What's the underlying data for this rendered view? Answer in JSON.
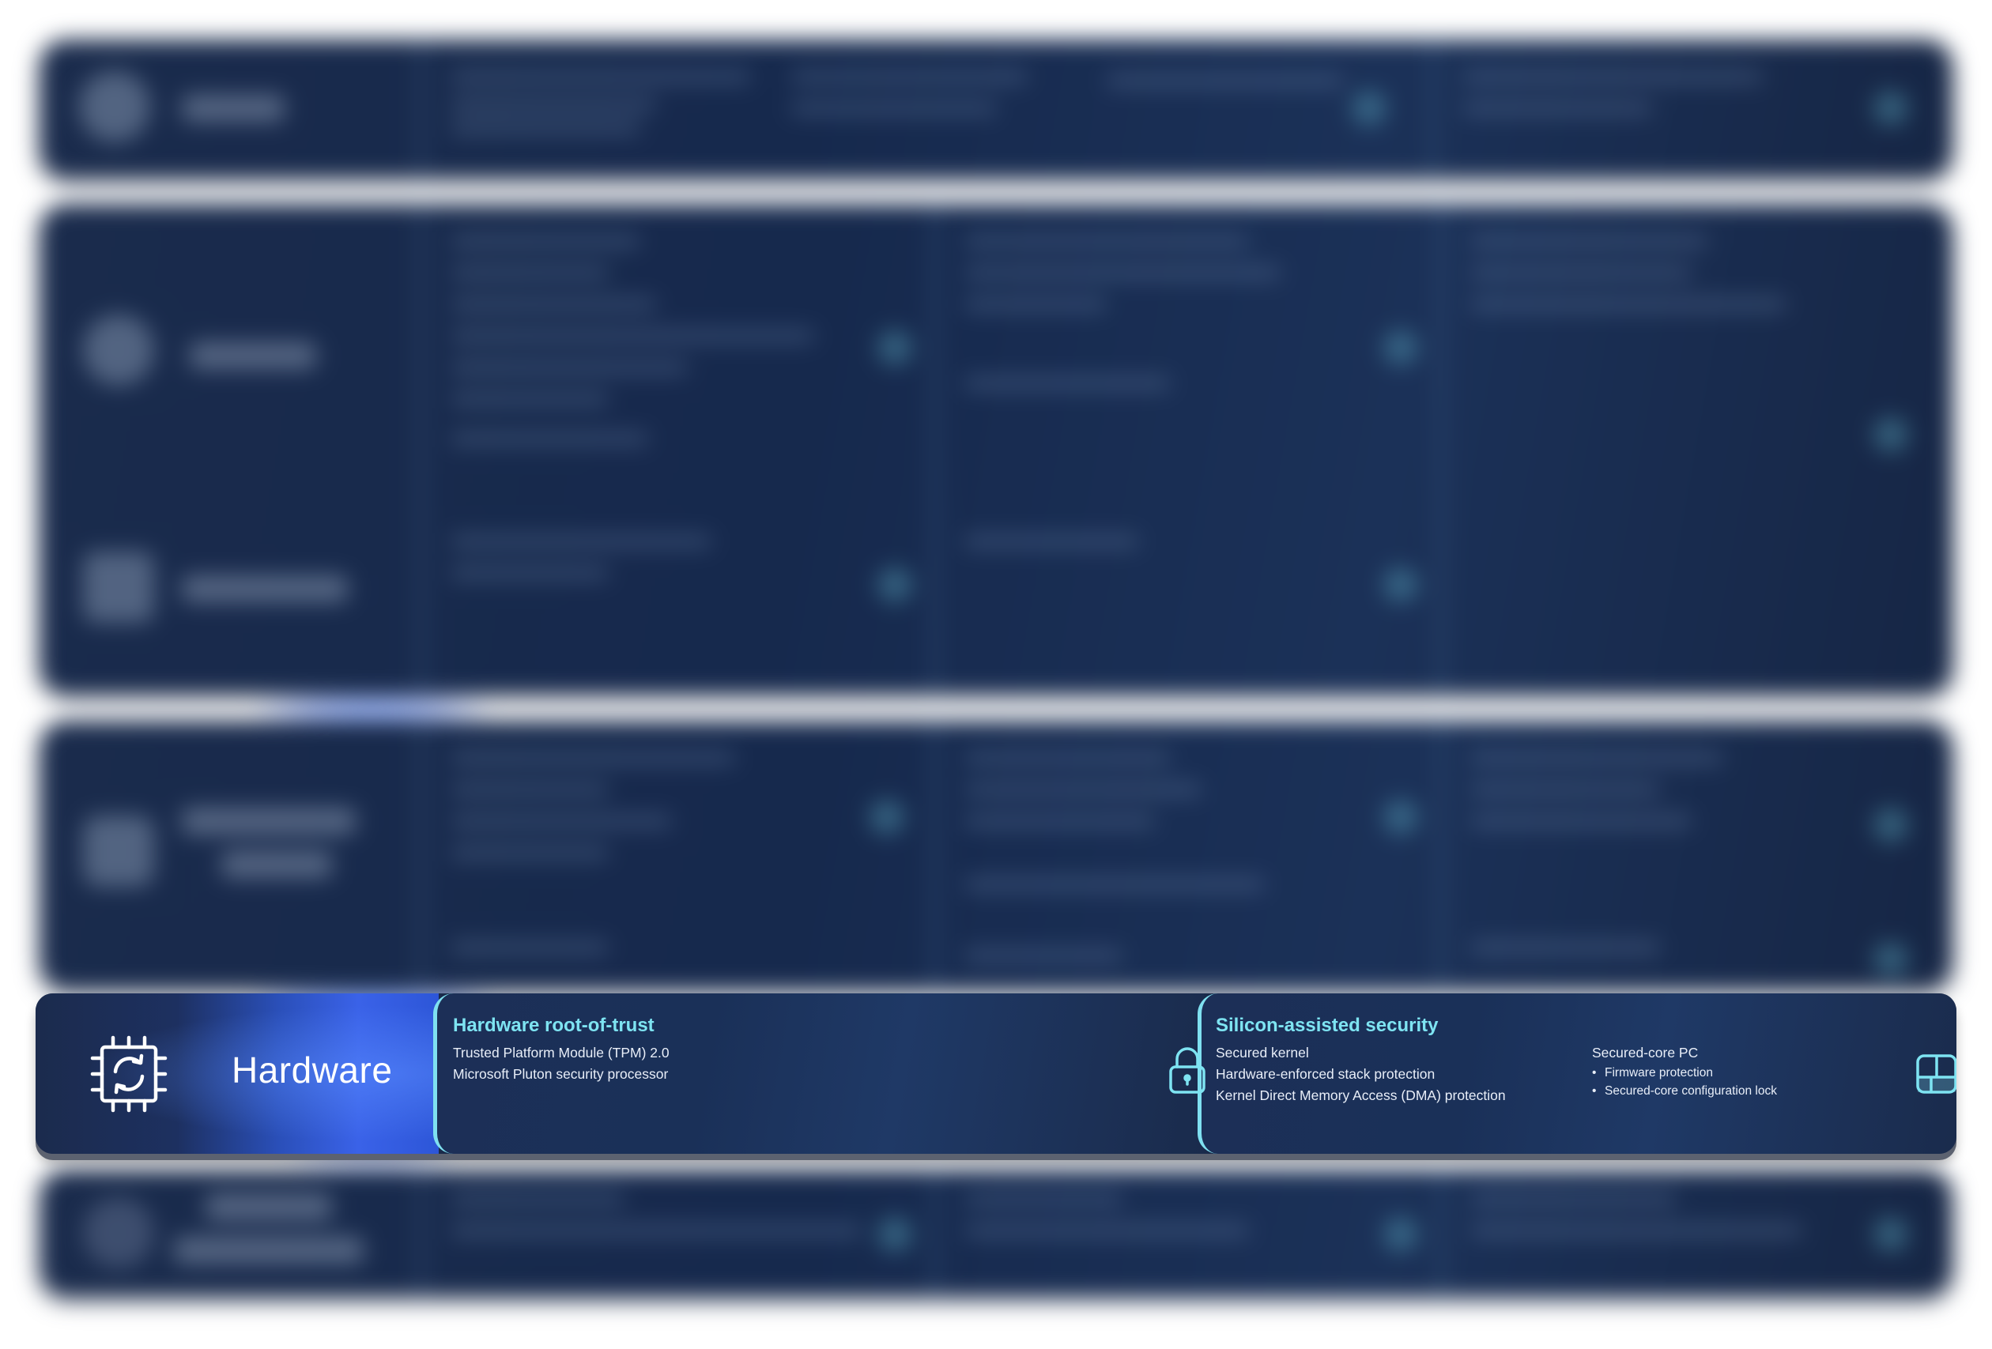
{
  "hardware_row": {
    "label": "Hardware",
    "label_icon": "chip-refresh-icon",
    "features": [
      {
        "title": "Hardware root-of-trust",
        "items": [
          "Trusted Platform Module (TPM) 2.0",
          "Microsoft Pluton security processor"
        ],
        "icon": "lock-icon"
      },
      {
        "title": "Silicon-assisted security",
        "items": [
          "Secured kernel",
          "Hardware-enforced stack protection",
          "Kernel Direct Memory Access (DMA) protection"
        ],
        "subgroup": {
          "heading": "Secured-core PC",
          "items": [
            "Firmware protection",
            "Secured-core configuration lock"
          ]
        },
        "icon": "panel-layout-icon"
      }
    ]
  },
  "colors": {
    "row_background": "#1a2a4a",
    "accent_cyan": "#7ee4f2",
    "label_glow": "#3a62e8",
    "text": "#e8eef8"
  }
}
